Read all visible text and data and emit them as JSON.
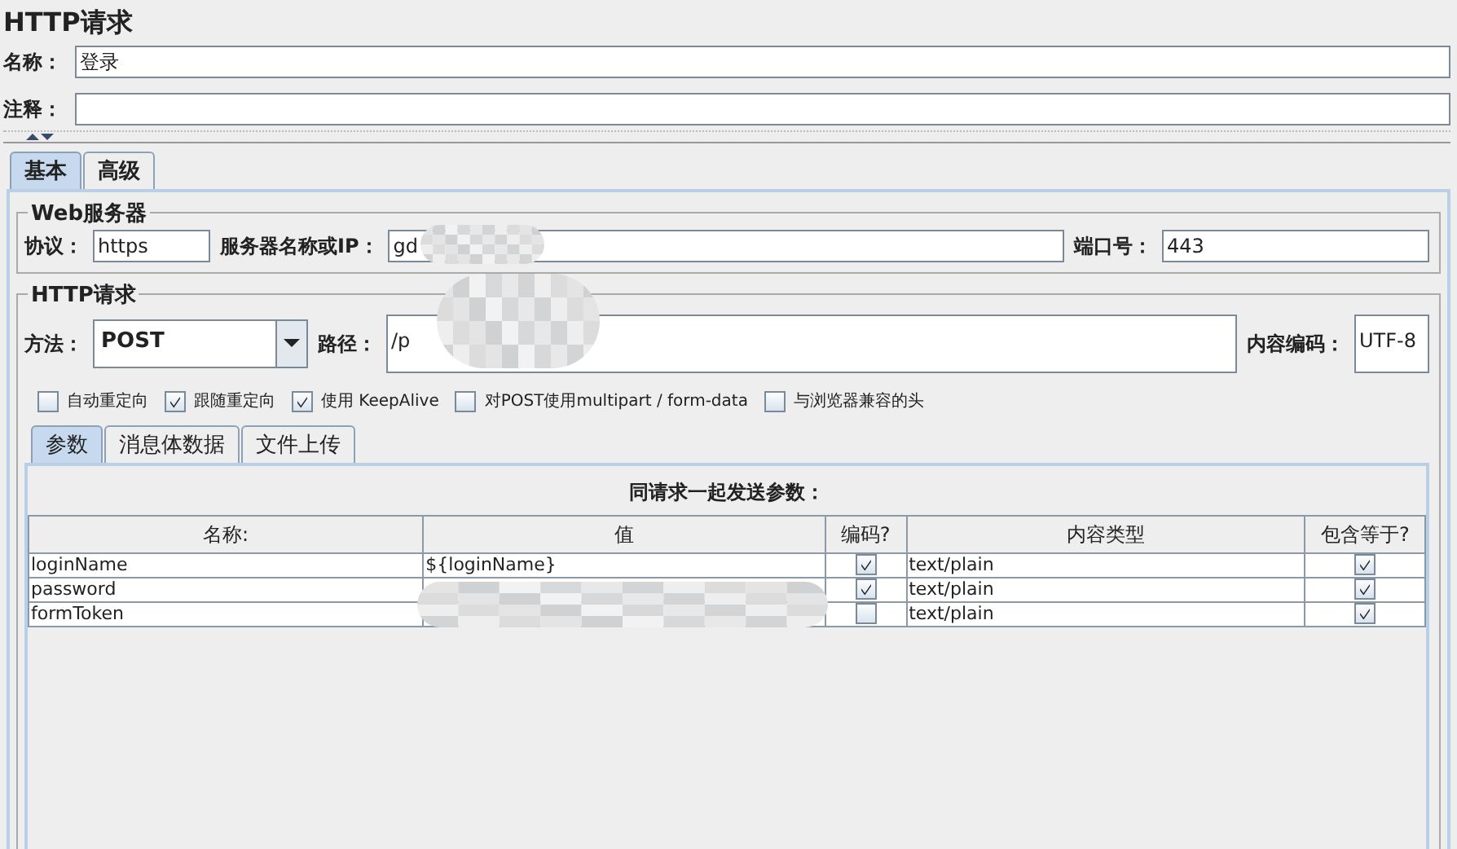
{
  "title": "HTTP请求",
  "fields": [
    {
      "label": "名称：",
      "value": "登录"
    },
    {
      "label": "注释："
    }
  ],
  "tabs": [
    {
      "label": "基本",
      "selected": true
    },
    {
      "label": "高级",
      "selected": false
    }
  ],
  "web_server": {
    "title": "Web服务器",
    "protocol": {
      "label": "协议：",
      "value": "https"
    },
    "server": {
      "label": "服务器名称或IP：",
      "value": "gd"
    },
    "port": {
      "label": "端口号：",
      "value": "443"
    }
  },
  "http_request": {
    "title": "HTTP请求",
    "method": {
      "label": "方法：",
      "value": "POST"
    },
    "path": {
      "label": "路径：",
      "value": "/p"
    },
    "encoding": {
      "label": "内容编码：",
      "value": "UTF-8"
    },
    "options": [
      {
        "label": "自动重定向",
        "checked": false
      },
      {
        "label": "跟随重定向",
        "checked": true
      },
      {
        "label": "使用 KeepAlive",
        "checked": true
      },
      {
        "label": "对POST使用multipart / form-data",
        "checked": false
      },
      {
        "label": "与浏览器兼容的头",
        "checked": false
      }
    ],
    "sub_tabs": [
      {
        "label": "参数",
        "selected": true
      },
      {
        "label": "消息体数据",
        "selected": false
      },
      {
        "label": "文件上传",
        "selected": false
      }
    ],
    "table": {
      "title": "同请求一起发送参数：",
      "columns": [
        "名称:",
        "值",
        "编码?",
        "内容类型",
        "包含等于?"
      ],
      "rows": [
        {
          "name": "loginName",
          "value": "${loginName}",
          "encode": true,
          "content_type": "text/plain",
          "include_equals": true
        },
        {
          "name": "password",
          "encode": true,
          "content_type": "text/plain",
          "include_equals": true
        },
        {
          "name": "formToken",
          "encode": false,
          "content_type": "text/plain",
          "include_equals": true
        }
      ]
    }
  }
}
